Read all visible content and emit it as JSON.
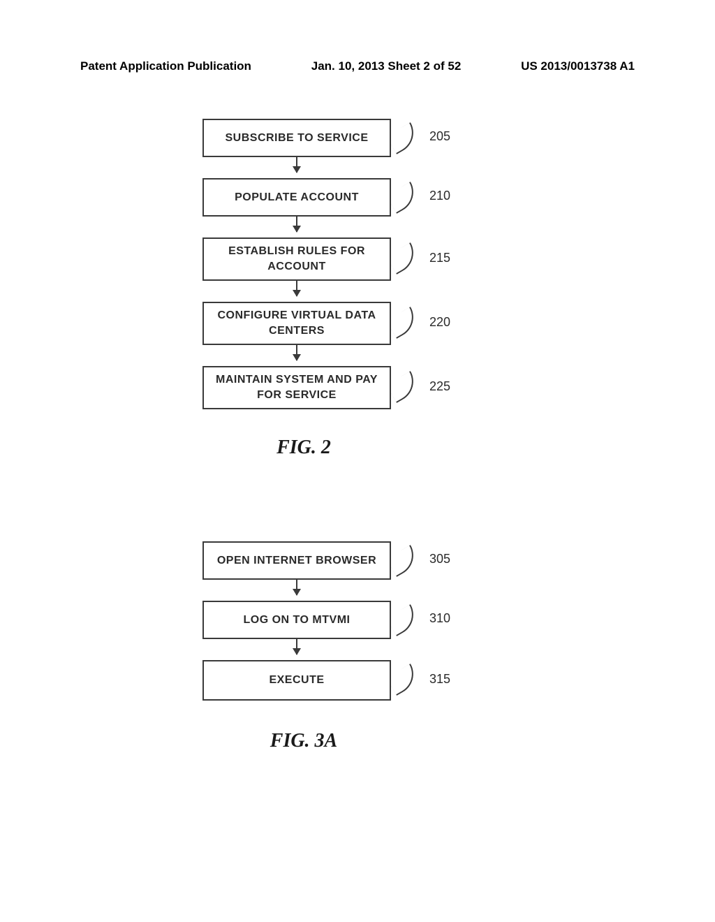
{
  "header": {
    "left": "Patent Application Publication",
    "center": "Jan. 10, 2013  Sheet 2 of 52",
    "right": "US 2013/0013738 A1"
  },
  "fig2": {
    "label": "FIG. 2",
    "steps": [
      {
        "text": "SUBSCRIBE TO SERVICE",
        "ref": "205"
      },
      {
        "text": "POPULATE ACCOUNT",
        "ref": "210"
      },
      {
        "text": "ESTABLISH RULES FOR ACCOUNT",
        "ref": "215"
      },
      {
        "text": "CONFIGURE VIRTUAL DATA CENTERS",
        "ref": "220"
      },
      {
        "text": "MAINTAIN SYSTEM AND PAY FOR SERVICE",
        "ref": "225"
      }
    ]
  },
  "fig3a": {
    "label": "FIG. 3A",
    "steps": [
      {
        "text": "OPEN INTERNET BROWSER",
        "ref": "305"
      },
      {
        "text": "LOG ON TO MTVMI",
        "ref": "310"
      },
      {
        "text": "EXECUTE",
        "ref": "315"
      }
    ]
  },
  "chart_data": [
    {
      "type": "flowchart",
      "title": "FIG. 2",
      "nodes": [
        {
          "id": "205",
          "label": "SUBSCRIBE TO SERVICE"
        },
        {
          "id": "210",
          "label": "POPULATE ACCOUNT"
        },
        {
          "id": "215",
          "label": "ESTABLISH RULES FOR ACCOUNT"
        },
        {
          "id": "220",
          "label": "CONFIGURE VIRTUAL DATA CENTERS"
        },
        {
          "id": "225",
          "label": "MAINTAIN SYSTEM AND PAY FOR SERVICE"
        }
      ],
      "edges": [
        {
          "from": "205",
          "to": "210"
        },
        {
          "from": "210",
          "to": "215"
        },
        {
          "from": "215",
          "to": "220"
        },
        {
          "from": "220",
          "to": "225"
        }
      ]
    },
    {
      "type": "flowchart",
      "title": "FIG. 3A",
      "nodes": [
        {
          "id": "305",
          "label": "OPEN INTERNET BROWSER"
        },
        {
          "id": "310",
          "label": "LOG ON TO MTVMI"
        },
        {
          "id": "315",
          "label": "EXECUTE"
        }
      ],
      "edges": [
        {
          "from": "305",
          "to": "310"
        },
        {
          "from": "310",
          "to": "315"
        }
      ]
    }
  ]
}
